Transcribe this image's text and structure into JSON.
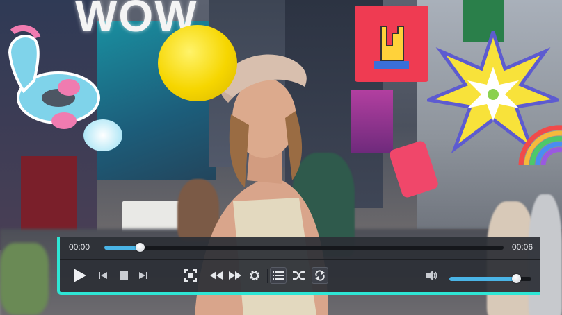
{
  "scene": {
    "sign_text": "WOW"
  },
  "player": {
    "current_time": "00:00",
    "duration": "00:06",
    "progress": 0.09,
    "volume": 0.82,
    "accent_color": "#2ee6d5",
    "fill_color": "#4ab4e6",
    "controls": [
      {
        "name": "play-button",
        "icon": "play-icon"
      },
      {
        "name": "previous-button",
        "icon": "skip-back-icon"
      },
      {
        "name": "stop-button",
        "icon": "stop-icon"
      },
      {
        "name": "next-button",
        "icon": "skip-forward-icon"
      },
      {
        "name": "fullscreen-button",
        "icon": "fullscreen-icon"
      },
      {
        "name": "rewind-button",
        "icon": "rewind-icon"
      },
      {
        "name": "fast-forward-button",
        "icon": "fast-forward-icon"
      },
      {
        "name": "settings-button",
        "icon": "gear-icon"
      },
      {
        "name": "playlist-button",
        "icon": "playlist-icon"
      },
      {
        "name": "shuffle-button",
        "icon": "shuffle-icon"
      },
      {
        "name": "repeat-button",
        "icon": "repeat-icon"
      },
      {
        "name": "volume-button",
        "icon": "speaker-icon"
      }
    ]
  }
}
